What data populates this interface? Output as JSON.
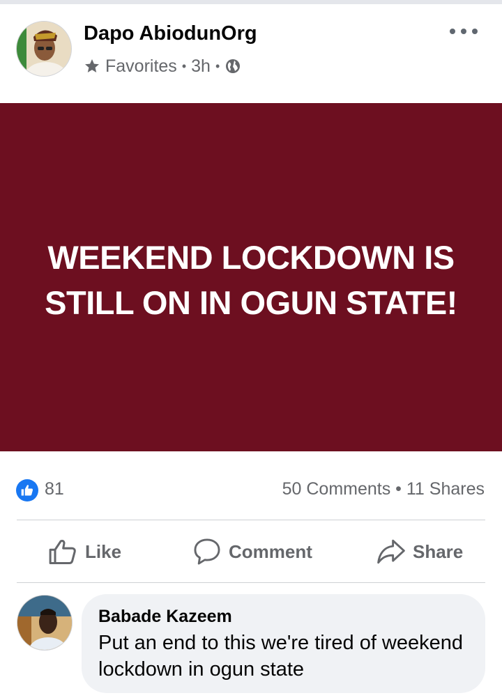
{
  "post": {
    "author": "Dapo AbiodunOrg",
    "audience": "Favorites",
    "separator": "•",
    "time": "3h",
    "image_text": "WEEKEND LOCKDOWN IS STILL ON IN OGUN STATE!",
    "image_color": "#6d0f20"
  },
  "stats": {
    "reactions": "81",
    "comments_shares": "50 Comments • 11 Shares"
  },
  "actions": {
    "like": "Like",
    "comment": "Comment",
    "share": "Share"
  },
  "comment": {
    "author": "Babade Kazeem",
    "text": "Put an end to this we're tired of weekend lockdown in ogun state"
  },
  "icons": {
    "audience": "star-icon",
    "privacy": "globe-icon",
    "menu": "more-icon",
    "reaction": "like-badge-icon"
  },
  "colors": {
    "accent": "#1877f2",
    "secondary_text": "#65676b",
    "bubble": "#f0f2f5"
  }
}
